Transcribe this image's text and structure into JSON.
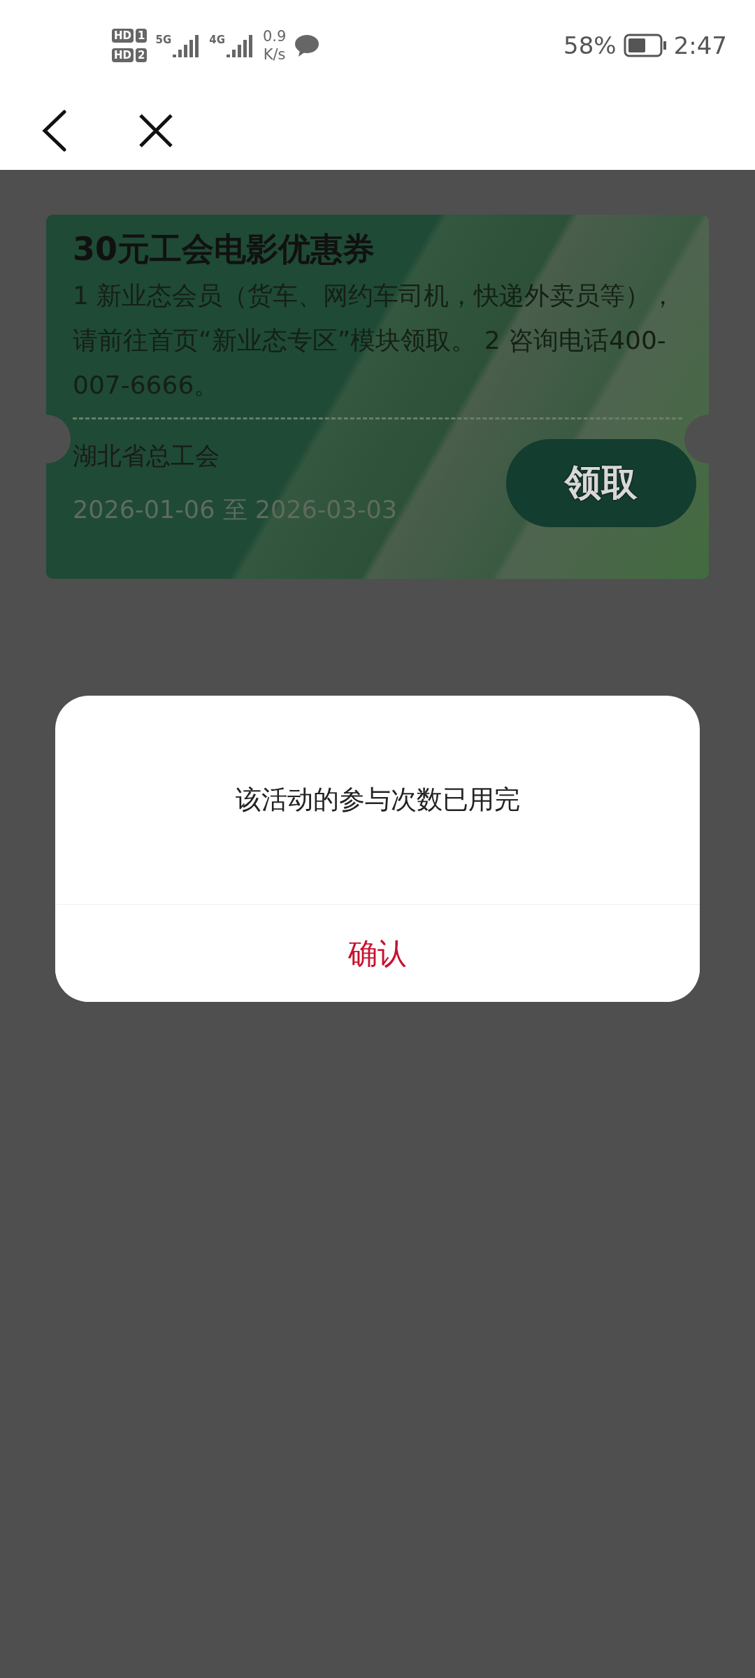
{
  "status_bar": {
    "sims": [
      {
        "label": "HD",
        "slot": "1"
      },
      {
        "label": "HD",
        "slot": "2"
      }
    ],
    "networks": [
      "5G",
      "4G"
    ],
    "speed_value": "0.9",
    "speed_unit": "K/s",
    "battery": "58%",
    "time": "2:47"
  },
  "coupon": {
    "title": "30元工会电影优惠券",
    "description": "1 新业态会员（货车、网约车司机，快递外卖员等），请前往首页“新业态专区”模块领取。 2 咨询电话400-007-6666。",
    "issuer": "湖北省总工会",
    "validity": "2026-01-06 至 2026-03-03",
    "button": "领取"
  },
  "dialog": {
    "message": "该活动的参与次数已用完",
    "confirm": "确认"
  }
}
